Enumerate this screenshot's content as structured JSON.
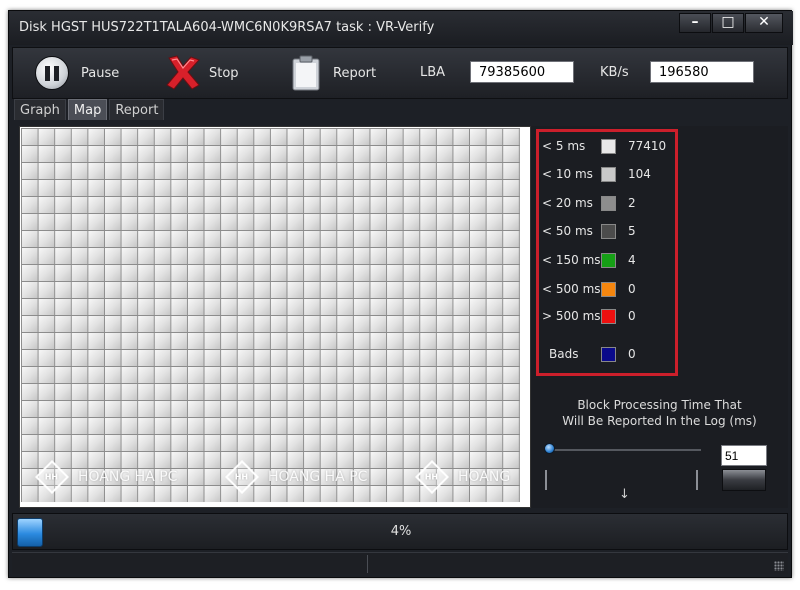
{
  "window": {
    "title": "Disk HGST HUS722T1TALA604-WMC6N0K9RSA7   task : VR-Verify"
  },
  "toolbar": {
    "pause_label": "Pause",
    "stop_label": "Stop",
    "report_label": "Report",
    "lba_label": "LBA",
    "lba_value": "79385600",
    "kbs_label": "KB/s",
    "kbs_value": "196580"
  },
  "tabs": [
    {
      "label": "Graph",
      "active": false
    },
    {
      "label": "Map",
      "active": true
    },
    {
      "label": "Report",
      "active": false
    }
  ],
  "watermark": {
    "text": "HOANG HA PC",
    "logo_text": "HH",
    "truncated_text": "HOANG"
  },
  "legend": [
    {
      "label": "< 5 ms",
      "color": "#e8e8e8",
      "count": "77410"
    },
    {
      "label": "< 10 ms",
      "color": "#c9c9c9",
      "count": "104"
    },
    {
      "label": "< 20 ms",
      "color": "#8d8d8d",
      "count": "2"
    },
    {
      "label": "< 50 ms",
      "color": "#4c4c4c",
      "count": "5"
    },
    {
      "label": "< 150 ms",
      "color": "#16a016",
      "count": "4"
    },
    {
      "label": "< 500 ms",
      "color": "#f5860f",
      "count": "0"
    },
    {
      "label": "> 500 ms",
      "color": "#ee1010",
      "count": "0"
    },
    {
      "label": "Bads",
      "color": "#0a0a8a",
      "count": "0"
    }
  ],
  "log_threshold": {
    "caption_line1": "Block Processing Time That",
    "caption_line2": "Will Be Reported In the Log (ms)",
    "value": "51"
  },
  "progress": {
    "percent_text": "4%",
    "percent": 4
  },
  "colors": {
    "legend_border": "#cc1f2b",
    "window_bg": "#1d2026"
  }
}
